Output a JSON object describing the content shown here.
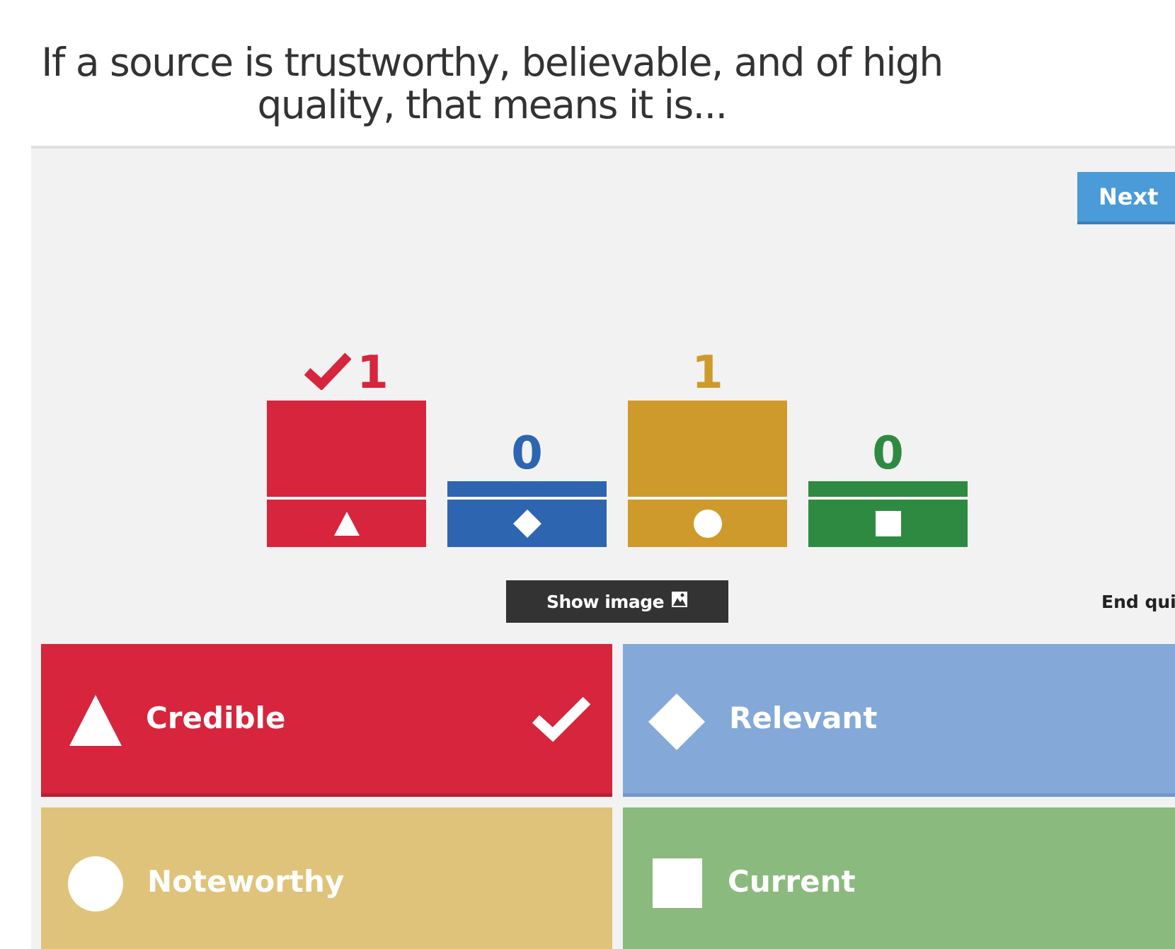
{
  "question": {
    "text": "If a source is trustworthy, believable, and of high quality, that means it is..."
  },
  "controls": {
    "next_label": "Next",
    "show_image_label": "Show image",
    "end_quiz_label": "End quiz"
  },
  "results": [
    {
      "count": "1",
      "color": "#d6253d",
      "shape": "triangle",
      "correct": true
    },
    {
      "count": "0",
      "color": "#2e65b0",
      "shape": "diamond",
      "correct": false
    },
    {
      "count": "1",
      "color": "#cf9a2c",
      "shape": "circle",
      "correct": false
    },
    {
      "count": "0",
      "color": "#2f8a41",
      "shape": "square",
      "correct": false
    }
  ],
  "answers": [
    {
      "label": "Credible",
      "shape": "triangle",
      "color": "#d6253d",
      "correct": true
    },
    {
      "label": "Relevant",
      "shape": "diamond",
      "color": "#84a8d8",
      "correct": false
    },
    {
      "label": "Noteworthy",
      "shape": "circle",
      "color": "#e0c37a",
      "correct": false
    },
    {
      "label": "Current",
      "shape": "square",
      "color": "#8bba7f",
      "correct": false
    }
  ]
}
